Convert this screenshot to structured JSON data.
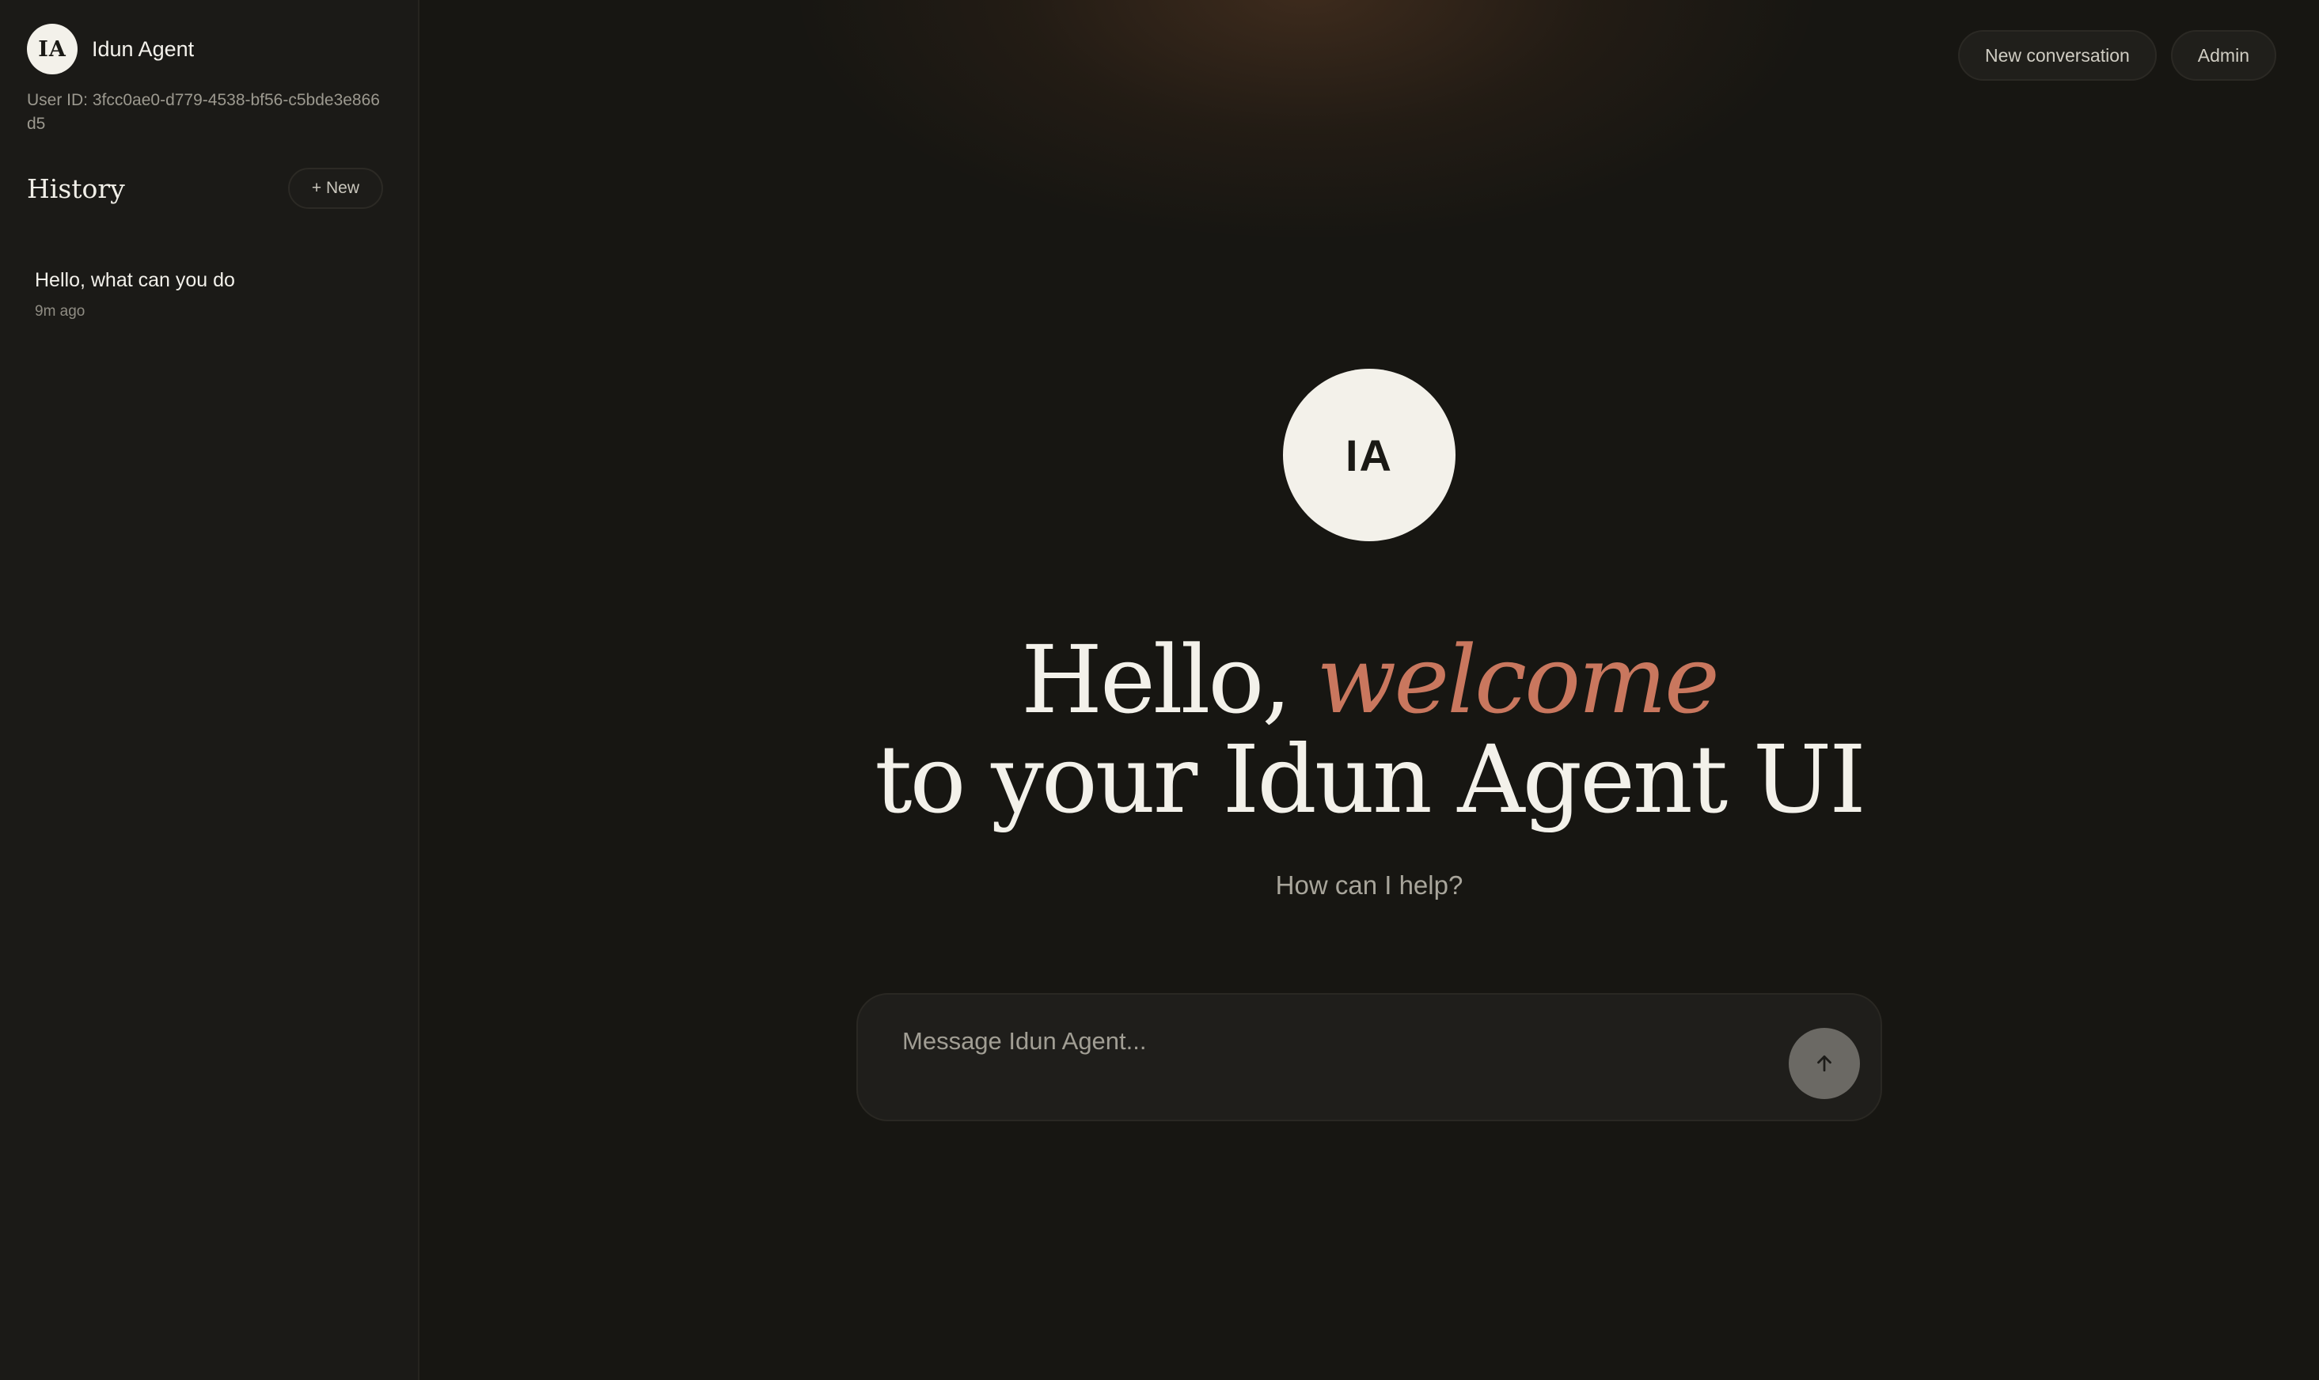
{
  "sidebar": {
    "brand": {
      "avatar_initials": "IA",
      "name": "Idun Agent"
    },
    "user_id": "User ID: 3fcc0ae0-d779-4538-bf56-c5bde3e866d5",
    "history": {
      "title": "History",
      "new_button_label": "+ New",
      "items": [
        {
          "title": "Hello, what can you do",
          "time": "9m ago"
        }
      ]
    }
  },
  "header": {
    "new_conversation_label": "New conversation",
    "admin_label": "Admin"
  },
  "hero": {
    "avatar_initials": "IA",
    "headline_line1_prefix": "Hello, ",
    "headline_line1_accent": "welcome",
    "headline_line2": "to your Idun Agent UI",
    "subtitle": "How can I help?"
  },
  "composer": {
    "placeholder": "Message Idun Agent...",
    "send_icon": "arrow-up-icon"
  },
  "colors": {
    "background": "#171612",
    "sidebar": "#1b1a17",
    "accent": "#c9775e",
    "avatar": "#f3f1ea"
  }
}
